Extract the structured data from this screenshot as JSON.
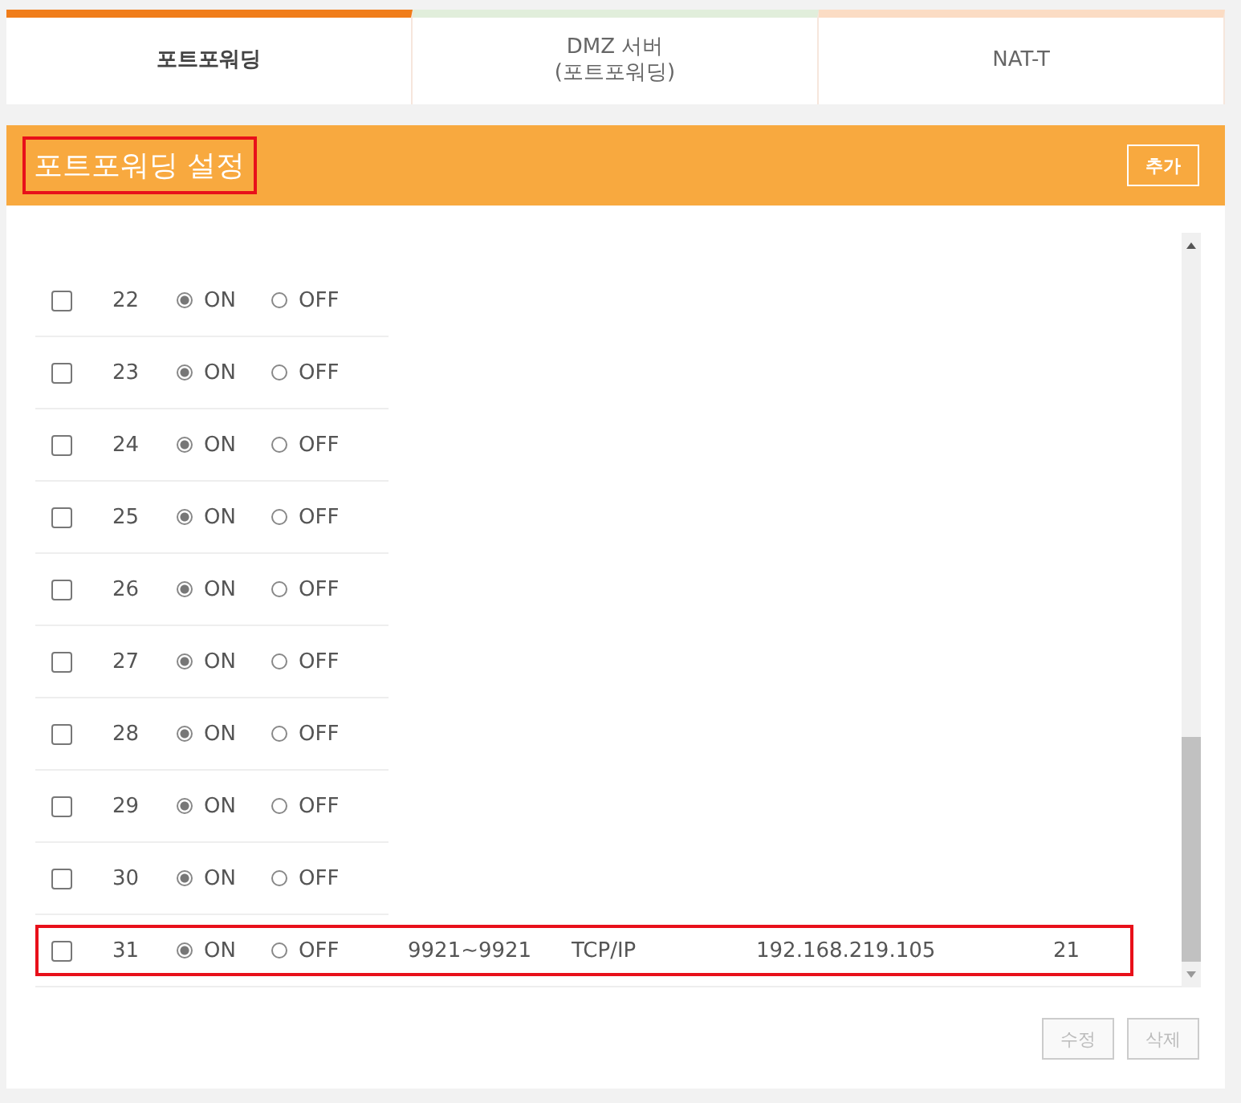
{
  "tabs": [
    {
      "label": "포트포워딩",
      "selected": true,
      "color": "#f07d1a"
    },
    {
      "label": "DMZ 서버\n(포트포워딩)",
      "selected": false,
      "color": "#e1eedb"
    },
    {
      "label": "NAT-T",
      "selected": false,
      "color": "#fbdcc4"
    }
  ],
  "panel": {
    "title": "포트포워딩 설정",
    "title_highlighted": true,
    "add_button": "추가"
  },
  "rows": [
    {
      "number": "22",
      "checked": false,
      "radios": [
        {
          "label": "ON",
          "selected": true
        },
        {
          "label": "OFF",
          "selected": false
        }
      ]
    },
    {
      "number": "23",
      "checked": false,
      "radios": [
        {
          "label": "ON",
          "selected": true
        },
        {
          "label": "OFF",
          "selected": false
        }
      ]
    },
    {
      "number": "24",
      "checked": false,
      "radios": [
        {
          "label": "ON",
          "selected": true
        },
        {
          "label": "OFF",
          "selected": false
        }
      ]
    },
    {
      "number": "25",
      "checked": false,
      "radios": [
        {
          "label": "ON",
          "selected": true
        },
        {
          "label": "OFF",
          "selected": false
        }
      ]
    },
    {
      "number": "26",
      "checked": false,
      "radios": [
        {
          "label": "ON",
          "selected": true
        },
        {
          "label": "OFF",
          "selected": false
        }
      ]
    },
    {
      "number": "27",
      "checked": false,
      "radios": [
        {
          "label": "ON",
          "selected": true
        },
        {
          "label": "OFF",
          "selected": false
        }
      ]
    },
    {
      "number": "28",
      "checked": false,
      "radios": [
        {
          "label": "ON",
          "selected": true
        },
        {
          "label": "OFF",
          "selected": false
        }
      ]
    },
    {
      "number": "29",
      "checked": false,
      "radios": [
        {
          "label": "ON",
          "selected": true
        },
        {
          "label": "OFF",
          "selected": false
        }
      ]
    },
    {
      "number": "30",
      "checked": false,
      "radios": [
        {
          "label": "ON",
          "selected": true
        },
        {
          "label": "OFF",
          "selected": false
        }
      ]
    },
    {
      "number": "31",
      "checked": false,
      "highlighted": true,
      "radios": [
        {
          "label": "ON",
          "selected": true
        },
        {
          "label": "OFF",
          "selected": false
        }
      ],
      "ports": "9921~9921",
      "protocol": "TCP/IP",
      "ip": "192.168.219.105",
      "column_8": "21"
    }
  ],
  "buttons": [
    {
      "label": "수정",
      "disabled": true
    },
    {
      "label": "삭제",
      "disabled": true
    }
  ]
}
